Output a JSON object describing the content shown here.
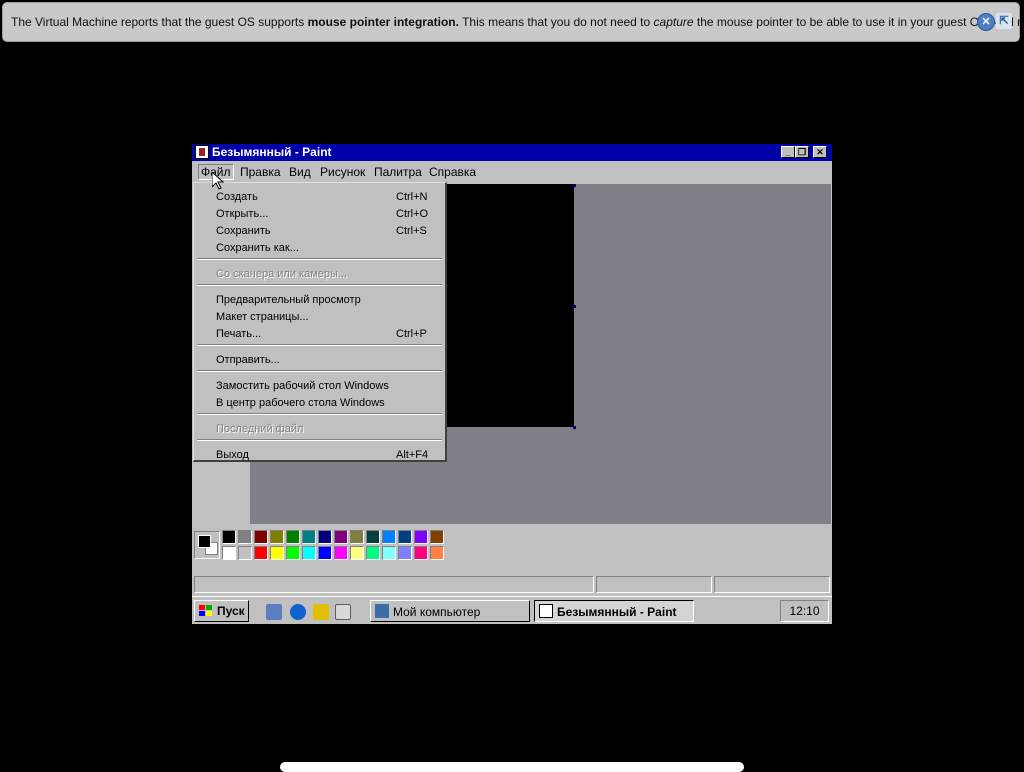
{
  "vm_notice": {
    "part1": "The Virtual Machine reports that the guest OS supports ",
    "bold": "mouse pointer integration.",
    "part2": " This means that you do not need to ",
    "italic": "capture",
    "part3": " the mouse pointer to be able to use it in your guest OS -- all mouse",
    "close_icon": "close-icon",
    "mouse_icon": "mouse-integration-icon"
  },
  "window": {
    "title": "Безымянный - Paint",
    "buttons": {
      "minimize": "_",
      "maximize": "❐",
      "close": "✕"
    }
  },
  "menubar": [
    "Файл",
    "Правка",
    "Вид",
    "Рисунок",
    "Палитра",
    "Справка"
  ],
  "file_menu": {
    "items": [
      {
        "label": "Создать",
        "shortcut": "Ctrl+N"
      },
      {
        "label": "Открыть...",
        "shortcut": "Ctrl+O"
      },
      {
        "label": "Сохранить",
        "shortcut": "Ctrl+S"
      },
      {
        "label": "Сохранить как...",
        "shortcut": ""
      },
      {
        "label": "Со сканера или камеры...",
        "shortcut": "",
        "disabled": true
      },
      {
        "label": "Предварительный просмотр",
        "shortcut": ""
      },
      {
        "label": "Макет страницы...",
        "shortcut": ""
      },
      {
        "label": "Печать...",
        "shortcut": "Ctrl+P"
      },
      {
        "label": "Отправить...",
        "shortcut": ""
      },
      {
        "label": "Замостить рабочий стол Windows",
        "shortcut": ""
      },
      {
        "label": "В центр рабочего стола Windows",
        "shortcut": ""
      },
      {
        "label": "Последний файл",
        "shortcut": "",
        "disabled": true
      },
      {
        "label": "Выход",
        "shortcut": "Alt+F4"
      }
    ]
  },
  "palette": {
    "foreground": "#000000",
    "background": "#ffffff",
    "row1": [
      "#000000",
      "#808080",
      "#800000",
      "#808000",
      "#008000",
      "#008080",
      "#000080",
      "#800080",
      "#808040",
      "#004040",
      "#0080ff",
      "#004080",
      "#8000ff",
      "#804000"
    ],
    "row2": [
      "#ffffff",
      "#c0c0c0",
      "#ff0000",
      "#ffff00",
      "#00ff00",
      "#00ffff",
      "#0000ff",
      "#ff00ff",
      "#ffff80",
      "#00ff80",
      "#80ffff",
      "#8080ff",
      "#ff0080",
      "#ff8040"
    ]
  },
  "taskbar": {
    "start_label": "Пуск",
    "tasks": [
      {
        "label": "Мой компьютер",
        "pressed": false
      },
      {
        "label": "Безымянный - Paint",
        "pressed": true
      }
    ],
    "clock": "12:10"
  }
}
